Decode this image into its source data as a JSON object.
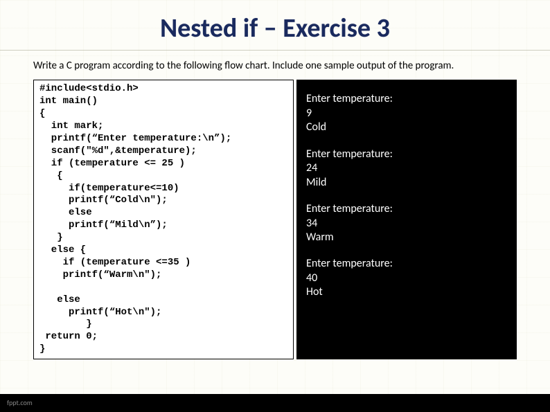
{
  "title": "Nested if – Exercise 3",
  "instruction": "Write a C program according to the following flow chart. Include one sample output of the program.",
  "code": "#include<stdio.h>\nint main()\n{\n  int mark;\n  printf(“Enter temperature:\\n”);\n  scanf(\"%d\",&temperature);\n  if (temperature <= 25 )\n   {\n     if(temperature<=10)\n     printf(“Cold\\n\");\n     else\n     printf(“Mild\\n”);\n   }\n  else {\n    if (temperature <=35 )\n    printf(“Warm\\n\");\n\n   else\n     printf(“Hot\\n\");\n        }\n return 0;\n}",
  "outputs": [
    {
      "prompt": "Enter temperature:",
      "input": "9",
      "result": "Cold"
    },
    {
      "prompt": "Enter temperature:",
      "input": "24",
      "result": "Mild"
    },
    {
      "prompt": "Enter temperature:",
      "input": "34",
      "result": "Warm"
    },
    {
      "prompt": "Enter temperature:",
      "input": "40",
      "result": "Hot"
    }
  ],
  "footer": "fppt.com"
}
